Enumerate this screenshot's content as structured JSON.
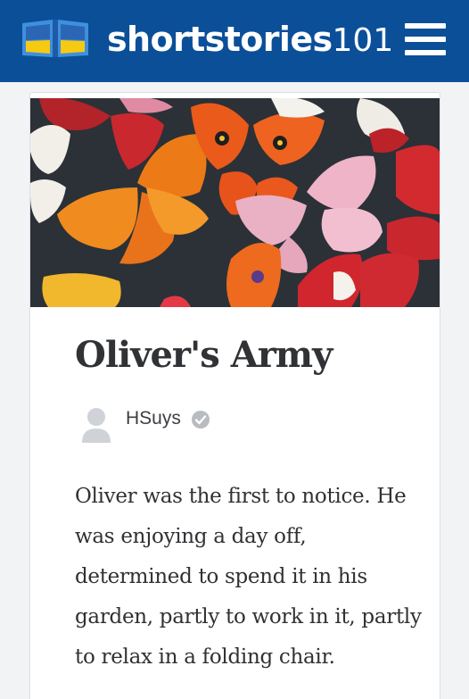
{
  "header": {
    "brand_bold": "shortstories",
    "brand_number": "101",
    "logo_icon": "open-book-icon",
    "menu_icon": "hamburger-menu-icon",
    "background": "#0b4f99"
  },
  "story": {
    "cover_image": "colorful-butterflies-illustration",
    "title": "Oliver's Army",
    "author": "HSuys",
    "author_verified_icon": "verified-check-icon",
    "body": "Oliver was the first to notice. He was enjoying a day off, determined to spend it in his garden, partly to work in it, partly to relax in a folding chair."
  }
}
